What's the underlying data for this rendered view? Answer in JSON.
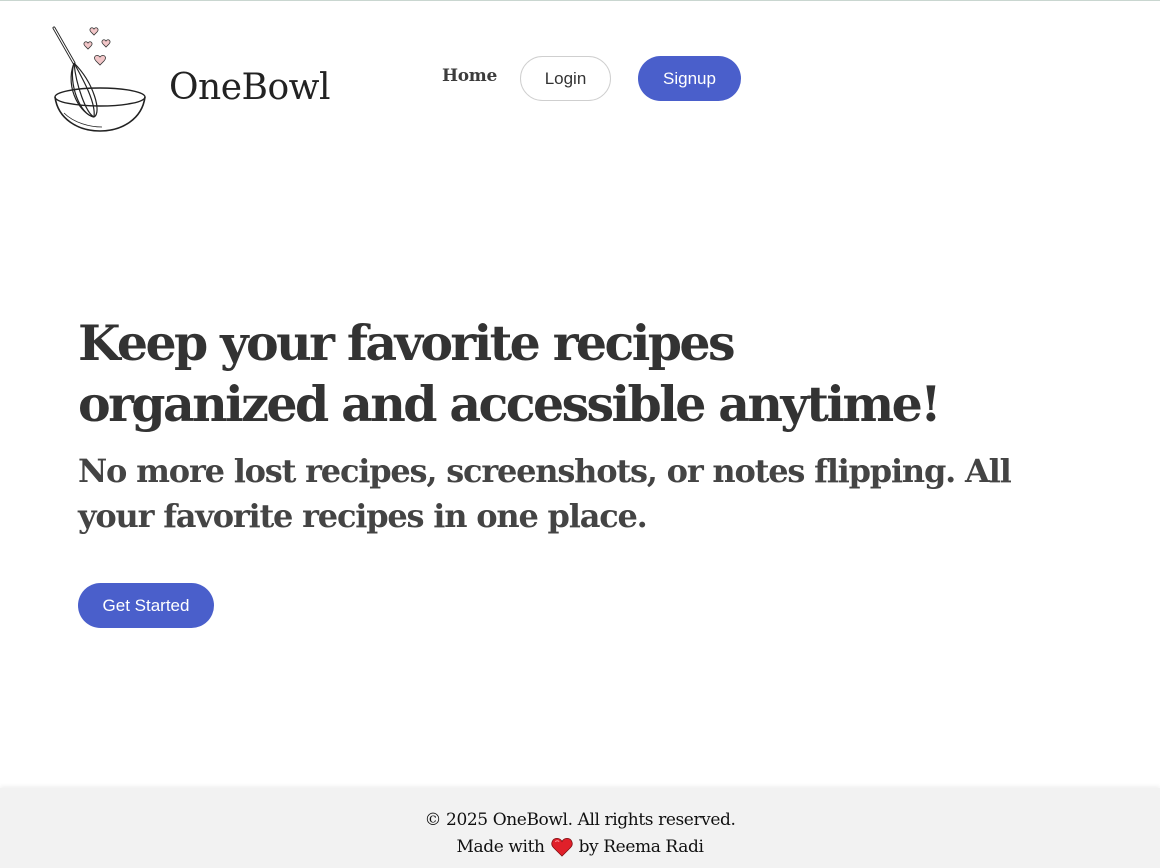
{
  "brand": {
    "name": "OneBowl",
    "logo_icon": "whisk-bowl-hearts-icon"
  },
  "nav": {
    "home_label": "Home",
    "login_label": "Login",
    "signup_label": "Signup"
  },
  "hero": {
    "title_line1": "Keep your favorite recipes",
    "title_line2": "organized and accessible anytime!",
    "subtitle": "No more lost recipes, screenshots, or notes flipping. All your favorite recipes in one place.",
    "cta_label": "Get Started"
  },
  "footer": {
    "copyright": "© 2025 OneBowl. All rights reserved.",
    "made_with": "Made with",
    "by": "by Reema Radi",
    "heart_icon": "heart-icon"
  },
  "colors": {
    "accent": "#4a5fcb",
    "footer_bg": "#f2f2f2",
    "heart": "#e0202a",
    "logo_hearts": "#f2c6c8"
  }
}
